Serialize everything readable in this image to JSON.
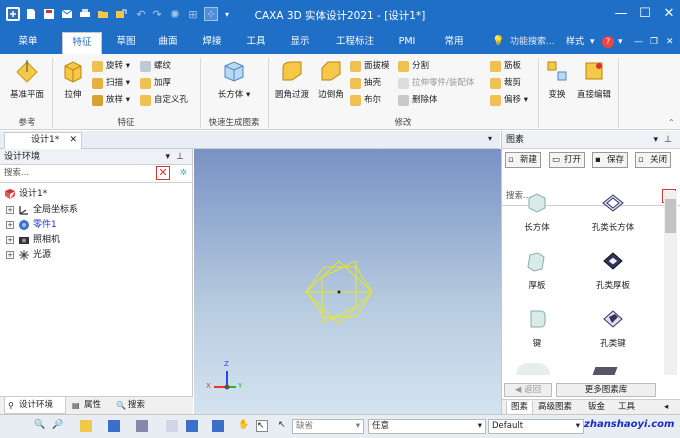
{
  "app": {
    "title": "CAXA 3D 实体设计2021 - [设计1*]"
  },
  "quick_access": {
    "icons": [
      "app-menu-icon",
      "new-icon",
      "save-icon",
      "mail-icon",
      "print-icon",
      "folder-icon",
      "export-icon",
      "undo-icon",
      "redo-icon",
      "globe-icon",
      "render-icon",
      "dropdown-icon"
    ]
  },
  "window_controls": {
    "minimize": "—",
    "maximize": "☐",
    "close": "✕"
  },
  "ribbon_tabs": [
    {
      "label": "菜单"
    },
    {
      "label": "特征"
    },
    {
      "label": "草图"
    },
    {
      "label": "曲面"
    },
    {
      "label": "焊接"
    },
    {
      "label": "工具"
    },
    {
      "label": "显示"
    },
    {
      "label": "工程标注"
    },
    {
      "label": "PMI"
    },
    {
      "label": "常用"
    }
  ],
  "ribbon_active_tab": "特征",
  "ribbon_right": {
    "search_placeholder": "功能搜索...",
    "style": "样式",
    "help": "?"
  },
  "ribbon": {
    "groups": [
      {
        "name": "参考",
        "buttons": [
          {
            "label": "基准平面"
          }
        ]
      },
      {
        "name": "特征",
        "buttons": [
          {
            "label": "拉伸"
          }
        ],
        "small": [
          {
            "label": "旋转"
          },
          {
            "label": "扫描"
          },
          {
            "label": "放样"
          },
          {
            "label": "螺纹"
          },
          {
            "label": "加厚"
          },
          {
            "label": "自定义孔"
          }
        ]
      },
      {
        "name": "快速生成图素",
        "buttons": [
          {
            "label": "长方体"
          }
        ]
      },
      {
        "name": "修改",
        "buttons": [
          {
            "label": "圆角过渡"
          },
          {
            "label": "边倒角"
          }
        ],
        "small": [
          {
            "label": "面拔模"
          },
          {
            "label": "抽壳"
          },
          {
            "label": "布尔"
          },
          {
            "label": "分割"
          },
          {
            "label": "拉伸零件/装配体"
          },
          {
            "label": "删除体"
          },
          {
            "label": "筋板"
          },
          {
            "label": "裁剪"
          },
          {
            "label": "偏移"
          }
        ]
      },
      {
        "name": "",
        "buttons": [
          {
            "label": "变换"
          },
          {
            "label": "直接编辑"
          }
        ]
      }
    ]
  },
  "doc_tab": {
    "label": "设计1*"
  },
  "left_panel": {
    "title": "设计环境",
    "search_placeholder": "搜索...",
    "tree": [
      {
        "label": "设计1*",
        "level": 0,
        "expanded": true
      },
      {
        "label": "全局坐标系",
        "level": 1
      },
      {
        "label": "零件1",
        "level": 1,
        "highlight": true
      },
      {
        "label": "照相机",
        "level": 1
      },
      {
        "label": "光源",
        "level": 1
      }
    ],
    "bottom_tabs": [
      {
        "label": "设计环境"
      },
      {
        "label": "属性"
      },
      {
        "label": "搜索"
      }
    ]
  },
  "viewport": {
    "axis_labels": {
      "z": "Z",
      "x": "X",
      "y": "Y"
    }
  },
  "right_panel": {
    "title": "图素",
    "buttons": [
      {
        "label": "新建"
      },
      {
        "label": "打开"
      },
      {
        "label": "保存"
      },
      {
        "label": "关闭"
      }
    ],
    "search_placeholder": "搜索...",
    "items": [
      {
        "label": "长方体"
      },
      {
        "label": "孔类长方体"
      },
      {
        "label": "厚板"
      },
      {
        "label": "孔类厚板"
      },
      {
        "label": "键"
      },
      {
        "label": "孔类键"
      }
    ],
    "back": "返回",
    "more": "更多图素库",
    "bottom_tabs": [
      {
        "label": "图素"
      },
      {
        "label": "高级图素"
      },
      {
        "label": "钣金"
      },
      {
        "label": "工具"
      }
    ]
  },
  "status_bar": {
    "dropdown1": "缺省",
    "dropdown2": "任意",
    "dropdown3": "Default",
    "watermark": "zhanshaoyi.com"
  },
  "colors": {
    "accent": "#1f6fc7",
    "highlight_text": "#1a33cc"
  }
}
